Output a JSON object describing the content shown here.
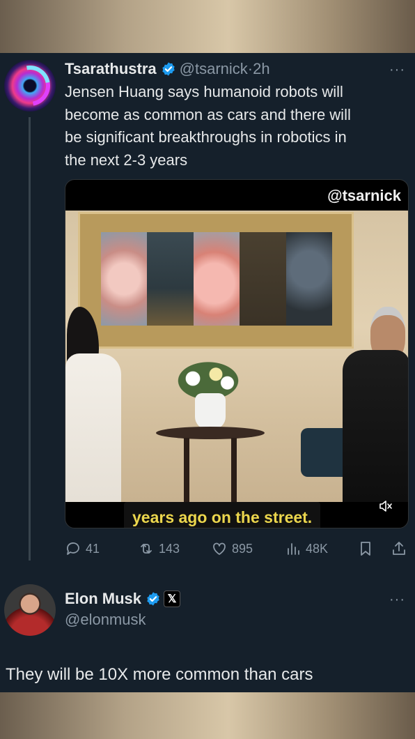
{
  "tweet": {
    "author_name": "Tsarathustra",
    "handle": "@tsarnick",
    "separator": "·",
    "time": "2h",
    "more": "···",
    "text": "Jensen Huang says humanoid robots will\nbecome as common as cars and there will\nbe significant breakthroughs in robotics in\nthe next 2-3 years",
    "media": {
      "watermark": "@tsarnick",
      "caption": "years ago on the street.",
      "mute_icon": "muted-speaker-icon"
    },
    "actions": {
      "replies": "41",
      "reposts": "143",
      "likes": "895",
      "views": "48K"
    }
  },
  "reply": {
    "author_name": "Elon Musk",
    "handle": "@elonmusk",
    "badge": "𝕏",
    "more": "···",
    "text": "They will be 10X more common than cars"
  },
  "colors": {
    "background": "#15202b",
    "verified": "#1d9bf0",
    "muted_text": "#8b98a5",
    "caption_text": "#ecd64d"
  }
}
